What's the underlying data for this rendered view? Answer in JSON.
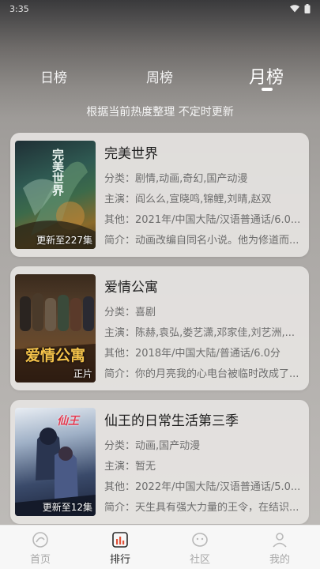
{
  "status_bar": {
    "time": "3:35"
  },
  "tabs": [
    {
      "label": "日榜"
    },
    {
      "label": "周榜"
    },
    {
      "label": "月榜"
    }
  ],
  "subtitle": "根据当前热度整理 不定时更新",
  "cards": [
    {
      "title": "完美世界",
      "poster_title": "完美世界",
      "badge": "更新至227集",
      "genre": "分类：剧情,动画,奇幻,国产动漫",
      "cast": "主演：阎么么,宣晓鸣,锦鲤,刘晴,赵双",
      "other": "其他：2021年/中国大陆/汉语普通话/6.0...",
      "summary": "简介：动画改编自同名小说。他为修道而..."
    },
    {
      "title": "爱情公寓",
      "poster_title": "爱情公寓",
      "badge": "正片",
      "genre": "分类：喜剧",
      "cast": "主演：陈赫,袁弘,娄艺潇,邓家佳,刘艺洲,...",
      "other": "其他：2018年/中国大陆/普通话/6.0分",
      "summary": "简介：你的月亮我的心电台被临时改成了..."
    },
    {
      "title": "仙王的日常生活第三季",
      "poster_title": "仙王",
      "badge": "更新至12集",
      "genre": "分类：动画,国产动漫",
      "cast": "主演：暂无",
      "other": "其他：2022年/中国大陆/汉语普通话/5.0...",
      "summary": "简介：天生具有强大力量的王令，在结识..."
    }
  ],
  "bottom_nav": [
    {
      "label": "首页",
      "icon": "home-icon"
    },
    {
      "label": "排行",
      "icon": "ranking-icon",
      "active": true
    },
    {
      "label": "社区",
      "icon": "community-icon"
    },
    {
      "label": "我的",
      "icon": "profile-icon"
    }
  ]
}
